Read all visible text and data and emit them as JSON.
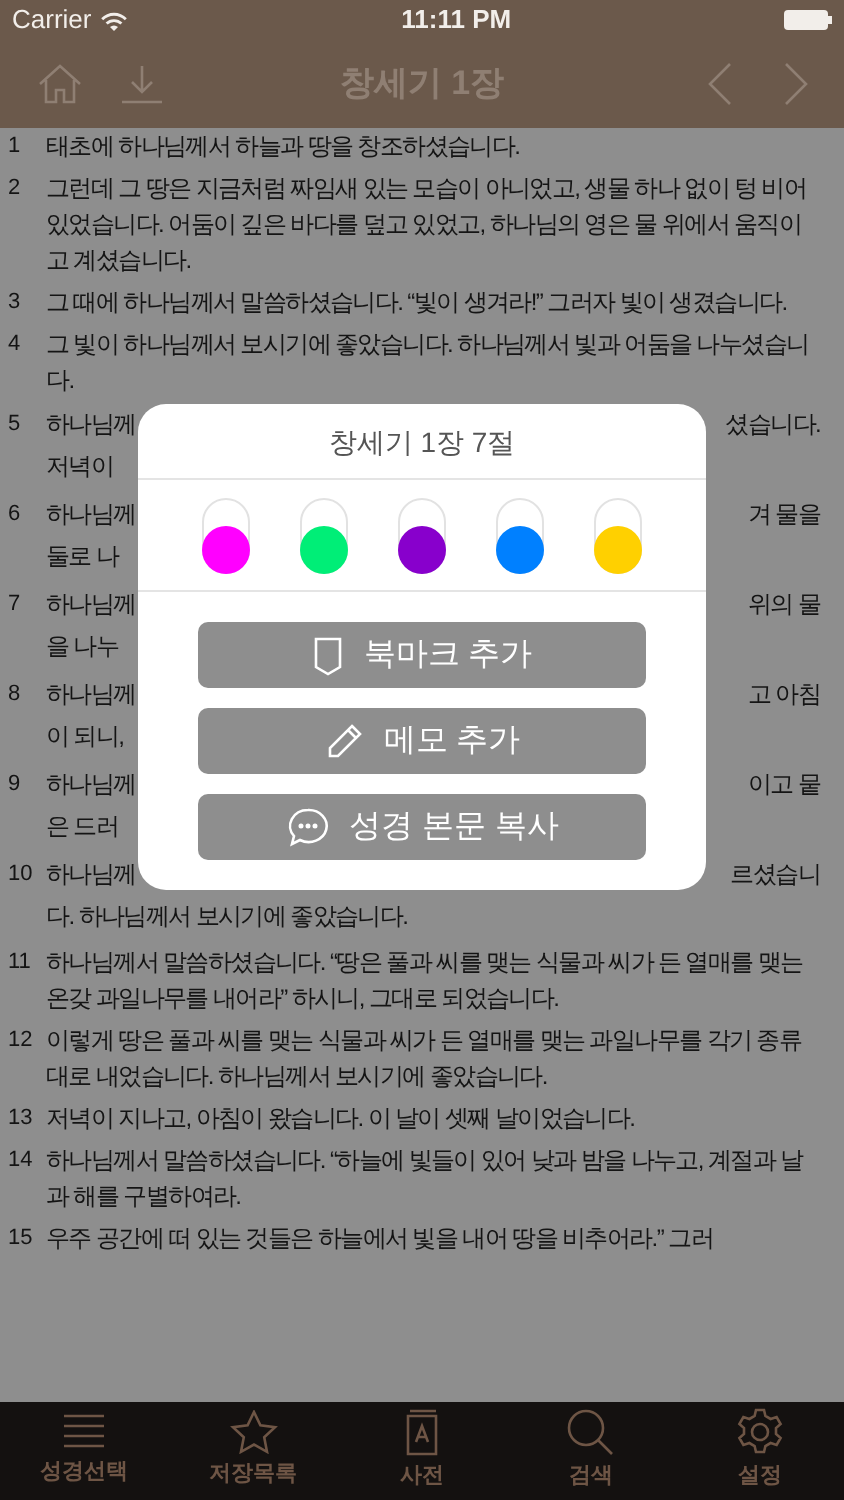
{
  "status_bar": {
    "carrier": "Carrier",
    "time": "11:11 PM"
  },
  "nav": {
    "title": "창세기 1장"
  },
  "verses": [
    {
      "number": "1",
      "text": "태초에 하나님께서 하늘과 땅을 창조하셨습니다."
    },
    {
      "number": "2",
      "text": "그런데 그 땅은 지금처럼 짜임새 있는 모습이 아니었고, 생물 하나 없이 텅 비어 있었습니다. 어둠이 깊은 바다를 덮고 있었고, 하나님의 영은 물 위에서 움직이고 계셨습니다."
    },
    {
      "number": "3",
      "text": "그 때에 하나님께서 말씀하셨습니다. “빛이 생겨라!” 그러자 빛이 생겼습니다."
    },
    {
      "number": "4",
      "text": "그 빛이 하나님께서 보시기에 좋았습니다. 하나님께서 빛과 어둠을 나누셨습니다."
    },
    {
      "number": "5",
      "lines": [
        {
          "left": "하나님께",
          "right": "셨습니다."
        },
        {
          "left": "저녁이"
        }
      ]
    },
    {
      "number": "6",
      "lines": [
        {
          "left": "하나님께",
          "right": "겨 물을"
        },
        {
          "left": "둘로 나"
        }
      ]
    },
    {
      "number": "7",
      "lines": [
        {
          "left": "하나님께",
          "right": "위의 물"
        },
        {
          "left": "을 나누"
        }
      ]
    },
    {
      "number": "8",
      "lines": [
        {
          "left": "하나님께",
          "right": "고 아침"
        },
        {
          "left": "이 되니,"
        }
      ]
    },
    {
      "number": "9",
      "lines": [
        {
          "left": "하나님께",
          "right": "이고 뭍"
        },
        {
          "left": "은 드러"
        }
      ]
    },
    {
      "number": "10",
      "lines": [
        {
          "left": "하나님께",
          "right": "르셨습니"
        },
        {
          "left": "다. 하나님께서 보시기에 좋았습니다."
        }
      ]
    },
    {
      "number": "11",
      "text": "하나님께서 말씀하셨습니다. “땅은 풀과 씨를 맺는 식물과 씨가 든 열매를 맺는 온갖 과일나무를 내어라” 하시니, 그대로 되었습니다."
    },
    {
      "number": "12",
      "text": "이렇게 땅은 풀과 씨를 맺는 식물과 씨가 든 열매를 맺는 과일나무를 각기 종류대로 내었습니다. 하나님께서 보시기에 좋았습니다."
    },
    {
      "number": "13",
      "text": "저녁이 지나고, 아침이 왔습니다. 이 날이 셋째 날이었습니다."
    },
    {
      "number": "14",
      "text": "하나님께서 말씀하셨습니다. “하늘에 빛들이 있어 낮과 밤을 나누고, 계절과 날과 해를 구별하여라."
    },
    {
      "number": "15",
      "text": "우주 공간에 떠 있는 것들은 하늘에서 빛을 내어 땅을 비추어라.” 그러"
    }
  ],
  "dialog": {
    "title": "창세기 1장 7절",
    "highlights": [
      {
        "color": "#ff00ff"
      },
      {
        "color": "#00ee77"
      },
      {
        "color": "#8800cc"
      },
      {
        "color": "#0080ff"
      },
      {
        "color": "#ffd000"
      }
    ],
    "actions": [
      {
        "kind": "bookmark",
        "label": "북마크 추가"
      },
      {
        "kind": "memo",
        "label": "메모 추가"
      },
      {
        "kind": "copy",
        "label": "성경 본문 복사"
      }
    ]
  },
  "tab_bar": [
    {
      "kind": "list",
      "label": "성경선택"
    },
    {
      "kind": "star",
      "label": "저장목록"
    },
    {
      "kind": "dictionary",
      "label": "사전"
    },
    {
      "kind": "search",
      "label": "검색"
    },
    {
      "kind": "settings",
      "label": "설정"
    }
  ]
}
